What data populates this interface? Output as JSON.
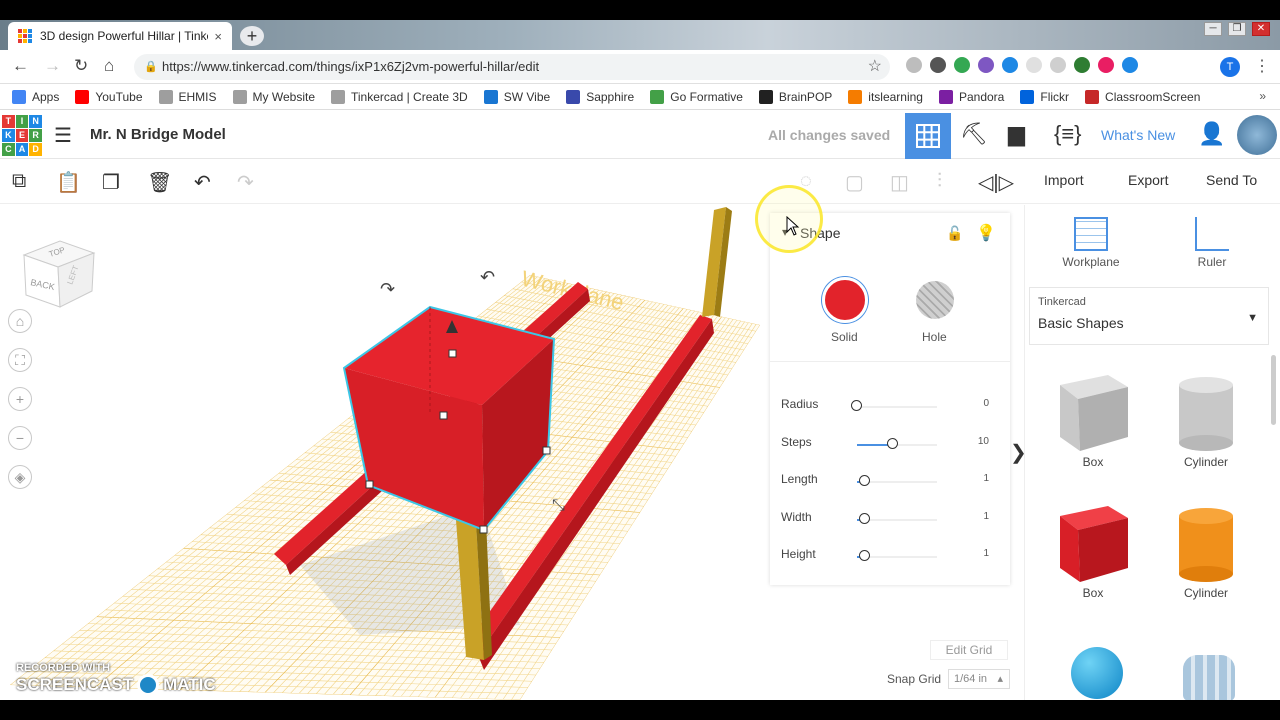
{
  "browser": {
    "tab_title": "3D design Powerful Hillar | Tinke",
    "tab_close": "×",
    "new_tab": "+",
    "url": "https://www.tinkercad.com/things/ixP1x6Zj2vm-powerful-hillar/edit",
    "lock_icon": "🔒",
    "profile_initial": "T",
    "window_controls": [
      "─",
      "❐",
      "✕"
    ],
    "bookmarks": [
      {
        "label": "Apps",
        "color": "#4285f4"
      },
      {
        "label": "YouTube",
        "color": "#ff0000"
      },
      {
        "label": "EHMIS",
        "color": "#9e9e9e"
      },
      {
        "label": "My Website",
        "color": "#9e9e9e"
      },
      {
        "label": "Tinkercad | Create 3D",
        "color": "#9e9e9e"
      },
      {
        "label": "SW Vibe",
        "color": "#1976d2"
      },
      {
        "label": "Sapphire",
        "color": "#3949ab"
      },
      {
        "label": "Go Formative",
        "color": "#43a047"
      },
      {
        "label": "BrainPOP",
        "color": "#212121"
      },
      {
        "label": "itslearning",
        "color": "#f57c00"
      },
      {
        "label": "Pandora",
        "color": "#7b1fa2"
      },
      {
        "label": "Flickr",
        "color": "#0063dc"
      },
      {
        "label": "ClassroomScreen",
        "color": "#c62828"
      }
    ],
    "bookmarks_more": "»"
  },
  "header": {
    "logo_letters": [
      "T",
      "I",
      "N",
      "K",
      "E",
      "R",
      "C",
      "A",
      "D"
    ],
    "design_title": "Mr. N Bridge Model",
    "save_status": "All changes saved",
    "whats_new": "What's New"
  },
  "toolbar": {
    "import": "Import",
    "export": "Export",
    "send_to": "Send To"
  },
  "viewcube": {
    "top": "TOP",
    "back": "BACK",
    "left": "LEFT"
  },
  "workplane_text": "Workplane",
  "inspector": {
    "title": "Shape",
    "solid_label": "Solid",
    "hole_label": "Hole",
    "solid_color": "#e2232b",
    "properties": [
      {
        "label": "Radius",
        "value": "0",
        "fraction": 0.0
      },
      {
        "label": "Steps",
        "value": "10",
        "fraction": 0.45
      },
      {
        "label": "Length",
        "value": "1",
        "fraction": 0.1
      },
      {
        "label": "Width",
        "value": "1",
        "fraction": 0.1
      },
      {
        "label": "Height",
        "value": "1",
        "fraction": 0.1
      }
    ]
  },
  "right_panel": {
    "workplane": "Workplane",
    "ruler": "Ruler",
    "library_source": "Tinkercad",
    "library_name": "Basic Shapes",
    "shapes": [
      {
        "label": "Box",
        "color": "#bdbdbd"
      },
      {
        "label": "Cylinder",
        "color": "#bdbdbd"
      },
      {
        "label": "Box",
        "color": "#e2232b"
      },
      {
        "label": "Cylinder",
        "color": "#f57f17"
      }
    ]
  },
  "grid": {
    "edit_grid": "Edit Grid",
    "snap_label": "Snap Grid",
    "snap_value": "1/64 in"
  },
  "watermark": {
    "line1": "RECORDED WITH",
    "left": "SCREENCAST",
    "right": "MATIC"
  },
  "colors": {
    "accent": "#4a90e2",
    "shape_red": "#e2232b",
    "beam_yellow": "#c9a227",
    "grid_line": "#f2c96a"
  }
}
